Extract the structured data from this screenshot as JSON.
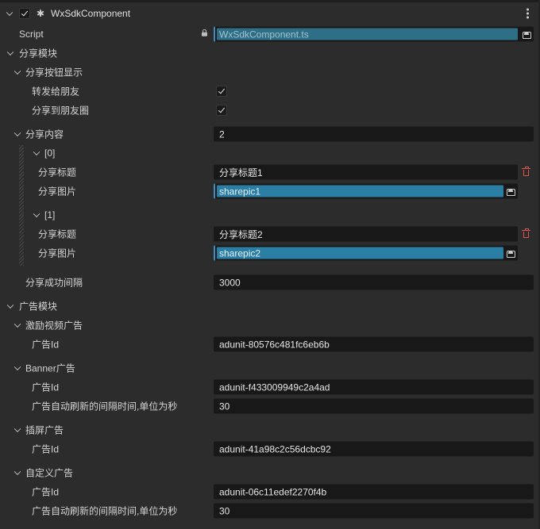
{
  "component": {
    "name": "WxSdkComponent",
    "enabled": true,
    "icon": "puzzle-icon",
    "menu_icon": "more-vertical-icon"
  },
  "script": {
    "label": "Script",
    "value": "WxSdkComponent.ts",
    "icon": "lock-icon"
  },
  "share": {
    "title": "分享模块",
    "button_section": {
      "title": "分享按钮显示",
      "forward_label": "转发给朋友",
      "forward_checked": true,
      "timeline_label": "分享到朋友圈",
      "timeline_checked": true
    },
    "content": {
      "title": "分享内容",
      "count": "2",
      "items": [
        {
          "index": "[0]",
          "title_label": "分享标题",
          "title_value": "分享标题1",
          "pic_label": "分享图片",
          "pic_value": "sharepic1"
        },
        {
          "index": "[1]",
          "title_label": "分享标题",
          "title_value": "分享标题2",
          "pic_label": "分享图片",
          "pic_value": "sharepic2"
        }
      ]
    },
    "interval_label": "分享成功间隔",
    "interval_value": "3000"
  },
  "ads": {
    "title": "广告模块",
    "reward": {
      "title": "激励视频广告",
      "id_label": "广告Id",
      "id_value": "adunit-80576c481fc6eb6b"
    },
    "banner": {
      "title": "Banner广告",
      "id_label": "广告Id",
      "id_value": "adunit-f433009949c2a4ad",
      "refresh_label": "广告自动刷新的间隔时间,单位为秒",
      "refresh_value": "30"
    },
    "interstitial": {
      "title": "插屏广告",
      "id_label": "广告Id",
      "id_value": "adunit-41a98c2c56dcbc92"
    },
    "custom": {
      "title": "自定义广告",
      "id_label": "广告Id",
      "id_value": "adunit-06c11edef2270f4b",
      "refresh_label": "广告自动刷新的间隔时间,单位为秒",
      "refresh_value": "30"
    }
  },
  "colors": {
    "background": "#2c2c2c",
    "field": "#181818",
    "asset_accent": "#2a7ea3",
    "delete": "#d9534f"
  }
}
